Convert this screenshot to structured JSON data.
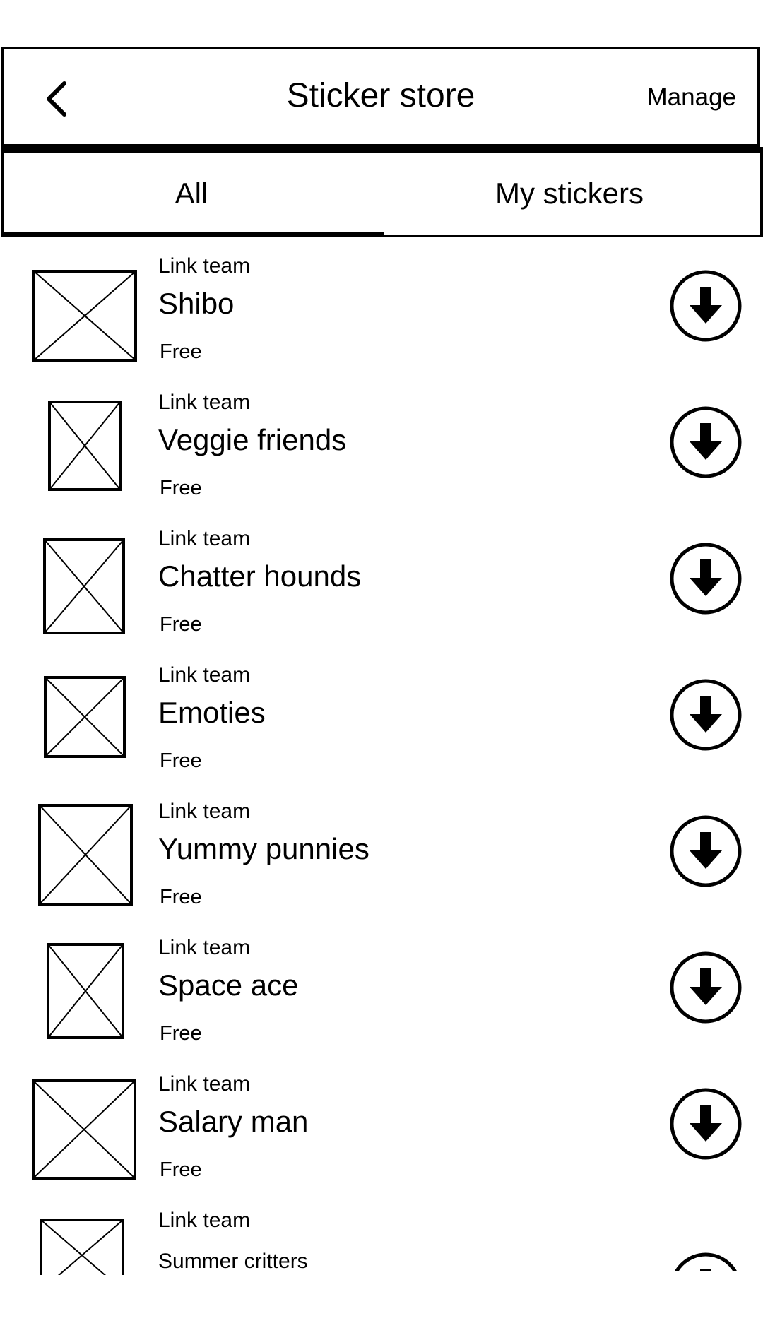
{
  "header": {
    "title": "Sticker store",
    "manage_label": "Manage",
    "back_icon": "chevron-left-icon"
  },
  "tabs": [
    {
      "label": "All",
      "selected": true
    },
    {
      "label": "My stickers",
      "selected": false
    }
  ],
  "stickers": [
    {
      "author": "Link team",
      "name": "Shibo",
      "price": "Free"
    },
    {
      "author": "Link team",
      "name": "Veggie friends",
      "price": "Free"
    },
    {
      "author": "Link team",
      "name": "Chatter hounds",
      "price": "Free"
    },
    {
      "author": "Link team",
      "name": "Emoties",
      "price": "Free"
    },
    {
      "author": "Link team",
      "name": "Yummy punnies",
      "price": "Free"
    },
    {
      "author": "Link team",
      "name": "Space ace",
      "price": "Free"
    },
    {
      "author": "Link team",
      "name": "Salary man",
      "price": "Free"
    },
    {
      "author": "Link team",
      "name": "Summer critters",
      "price": ""
    }
  ],
  "icons": {
    "download": "download-circle-icon",
    "thumbnail": "image-placeholder-icon"
  }
}
